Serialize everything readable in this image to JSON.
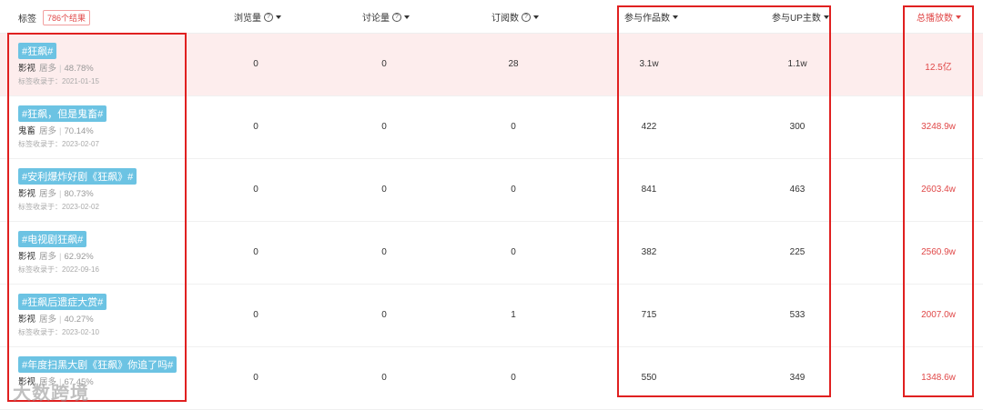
{
  "header": {
    "tag_label": "标签",
    "result_badge": "786个结果",
    "views_label": "浏览量",
    "discuss_label": "讨论量",
    "subscribe_label": "订阅数",
    "works_label": "参与作品数",
    "up_label": "参与UP主数",
    "plays_label": "总播放数",
    "help_glyph": "?"
  },
  "rows": [
    {
      "tag": "#狂飙#",
      "category": "影视",
      "sub": "居多",
      "pct": "48.78%",
      "date": "标签收录于：2021-01-15",
      "views": "0",
      "discuss": "0",
      "subscribe": "28",
      "works": "3.1w",
      "up": "1.1w",
      "plays": "12.5亿"
    },
    {
      "tag": "#狂飙，但是鬼畜#",
      "category": "鬼畜",
      "sub": "居多",
      "pct": "70.14%",
      "date": "标签收录于：2023-02-07",
      "views": "0",
      "discuss": "0",
      "subscribe": "0",
      "works": "422",
      "up": "300",
      "plays": "3248.9w"
    },
    {
      "tag": "#安利爆炸好剧《狂飙》#",
      "category": "影视",
      "sub": "居多",
      "pct": "80.73%",
      "date": "标签收录于：2023-02-02",
      "views": "0",
      "discuss": "0",
      "subscribe": "0",
      "works": "841",
      "up": "463",
      "plays": "2603.4w"
    },
    {
      "tag": "#电视剧狂飙#",
      "category": "影视",
      "sub": "居多",
      "pct": "62.92%",
      "date": "标签收录于：2022-09-16",
      "views": "0",
      "discuss": "0",
      "subscribe": "0",
      "works": "382",
      "up": "225",
      "plays": "2560.9w"
    },
    {
      "tag": "#狂飙后遗症大赏#",
      "category": "影视",
      "sub": "居多",
      "pct": "40.27%",
      "date": "标签收录于：2023-02-10",
      "views": "0",
      "discuss": "0",
      "subscribe": "1",
      "works": "715",
      "up": "533",
      "plays": "2007.0w"
    },
    {
      "tag": "#年度扫黑大剧《狂飙》你追了吗#",
      "category": "影视",
      "sub": "居多",
      "pct": "67.45%",
      "date": "",
      "views": "0",
      "discuss": "0",
      "subscribe": "0",
      "works": "550",
      "up": "349",
      "plays": "1348.6w"
    }
  ],
  "watermark": "大数跨境",
  "colors": {
    "accent_red": "#e04848",
    "chip_blue": "#6cc3e3",
    "highlight_row": "#fdeded",
    "annotation_box": "#e02020"
  }
}
